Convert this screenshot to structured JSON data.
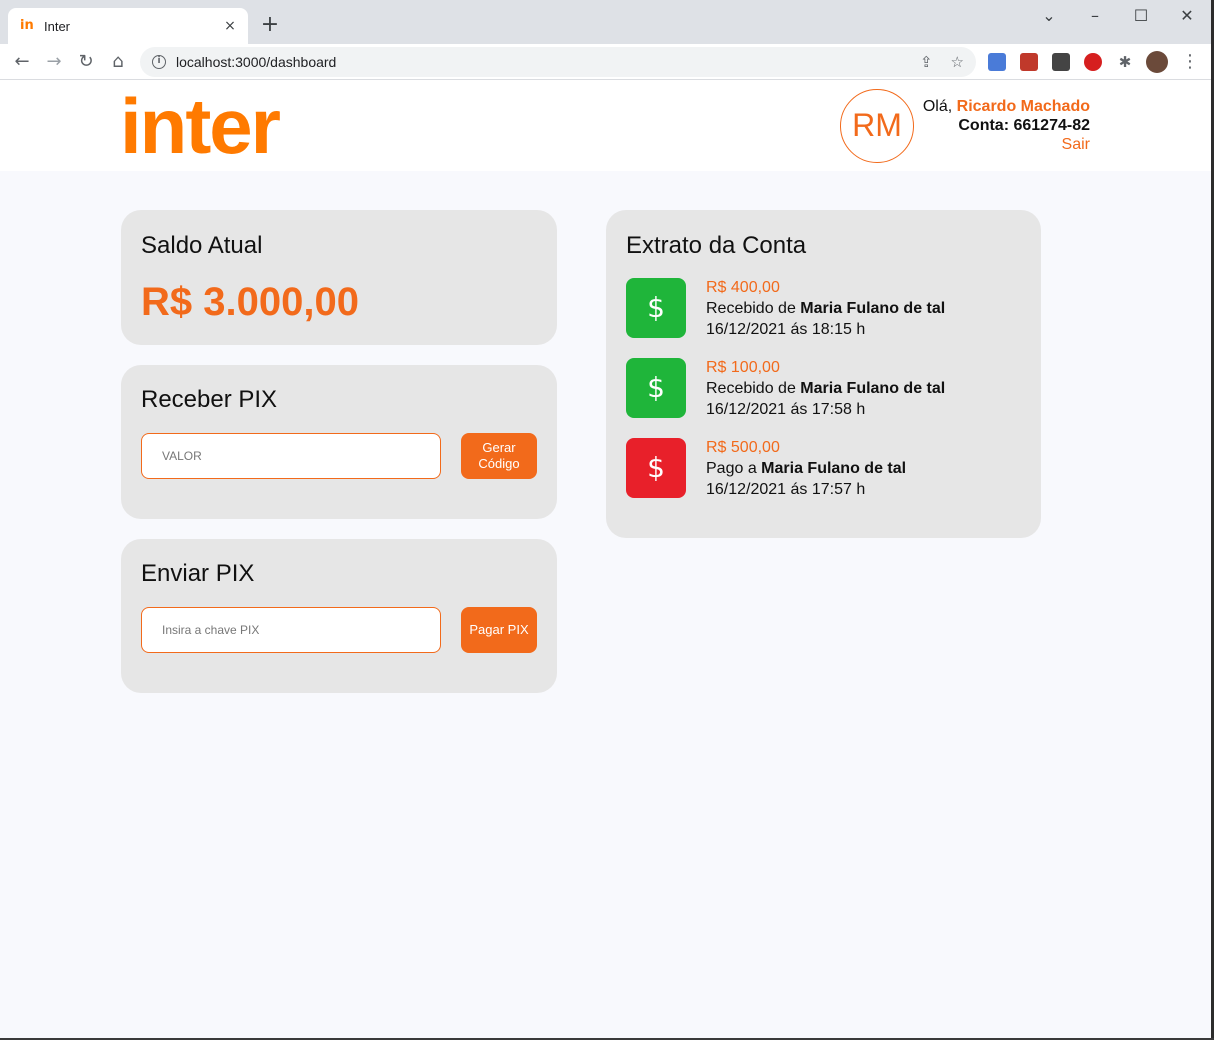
{
  "browser": {
    "tab_favicon": "in",
    "tab_title": "Inter",
    "tab_close": "×",
    "new_tab": "+",
    "url": "localhost:3000/dashboard",
    "window_controls": {
      "dropdown": "⌄",
      "minimize": "–",
      "maximize": "☐",
      "close": "✕"
    },
    "nav": {
      "back": "←",
      "forward": "→",
      "reload": "↻",
      "home": "⌂"
    },
    "actions": {
      "share": "⇪",
      "bookmark": "☆",
      "extensions": "✱",
      "menu": "⋮"
    },
    "info": "i"
  },
  "header": {
    "logo": "inter",
    "avatar_initials": "RM",
    "greeting": "Olá,",
    "user_name": "Ricardo Machado",
    "account_label": "Conta:",
    "account_number": "661274-82",
    "logout": "Sair"
  },
  "balance": {
    "title": "Saldo Atual",
    "value": "R$ 3.000,00"
  },
  "receive_pix": {
    "title": "Receber PIX",
    "placeholder": "VALOR",
    "button": "Gerar Código"
  },
  "send_pix": {
    "title": "Enviar PIX",
    "placeholder": "Insira a chave PIX",
    "button": "Pagar PIX"
  },
  "statement": {
    "title": "Extrato da Conta",
    "icon_glyph": "$",
    "transactions": [
      {
        "amount": "R$ 400,00",
        "prefix": "Recebido de",
        "name": "Maria Fulano de tal",
        "date": "16/12/2021 ás 18:15 h",
        "type": "credit",
        "color": "#1fb53a"
      },
      {
        "amount": "R$ 100,00",
        "prefix": "Recebido de",
        "name": "Maria Fulano de tal",
        "date": "16/12/2021 ás 17:58 h",
        "type": "credit",
        "color": "#1fb53a"
      },
      {
        "amount": "R$ 500,00",
        "prefix": "Pago a",
        "name": "Maria Fulano de tal",
        "date": "16/12/2021 ás 17:57 h",
        "type": "debit",
        "color": "#e8202a"
      }
    ]
  },
  "colors": {
    "accent": "#f26a1b",
    "card_bg": "#e6e6e6",
    "page_bg": "#f8f9fd"
  }
}
